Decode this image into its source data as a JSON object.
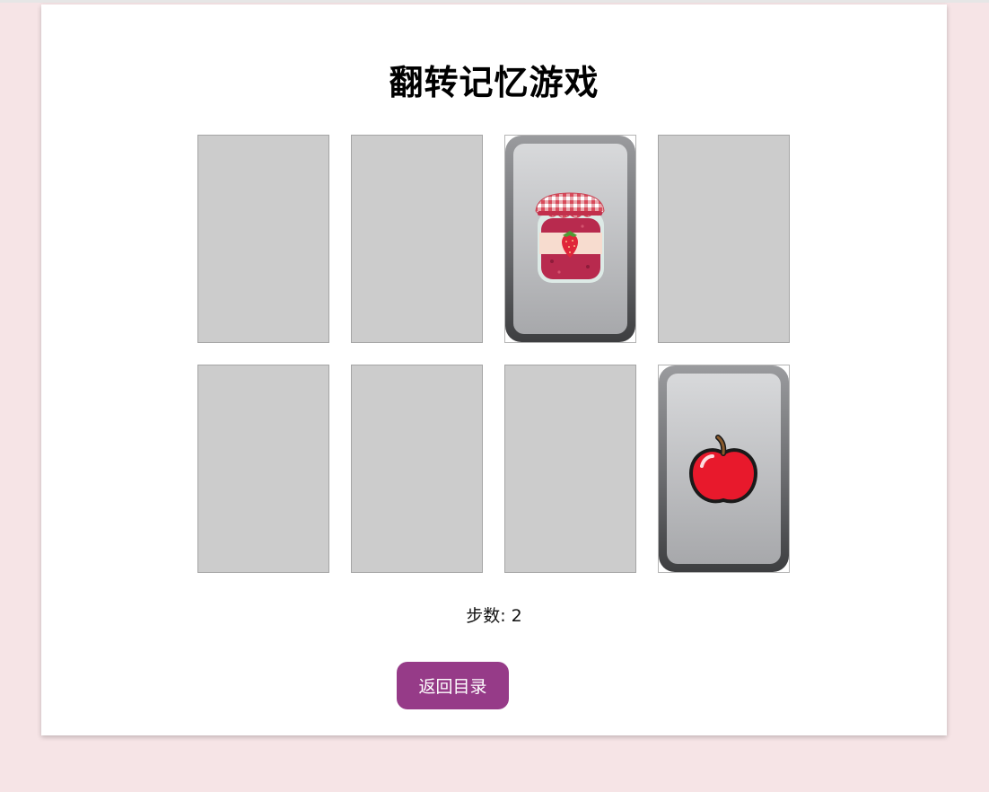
{
  "game": {
    "title": "翻转记忆游戏",
    "steps_label": "步数:",
    "steps_value": "2",
    "back_button_label": "返回目录"
  },
  "cards": [
    {
      "state": "face-down"
    },
    {
      "state": "face-down"
    },
    {
      "state": "face-up",
      "icon": "strawberry-jam-jar-icon"
    },
    {
      "state": "face-down"
    },
    {
      "state": "face-down"
    },
    {
      "state": "face-down"
    },
    {
      "state": "face-down"
    },
    {
      "state": "face-up",
      "icon": "red-apple-icon"
    }
  ],
  "colors": {
    "page_background": "#f6e4e6",
    "panel_background": "#ffffff",
    "card_back": "#cccccc",
    "button_background": "#963b88",
    "button_text": "#ffffff"
  }
}
